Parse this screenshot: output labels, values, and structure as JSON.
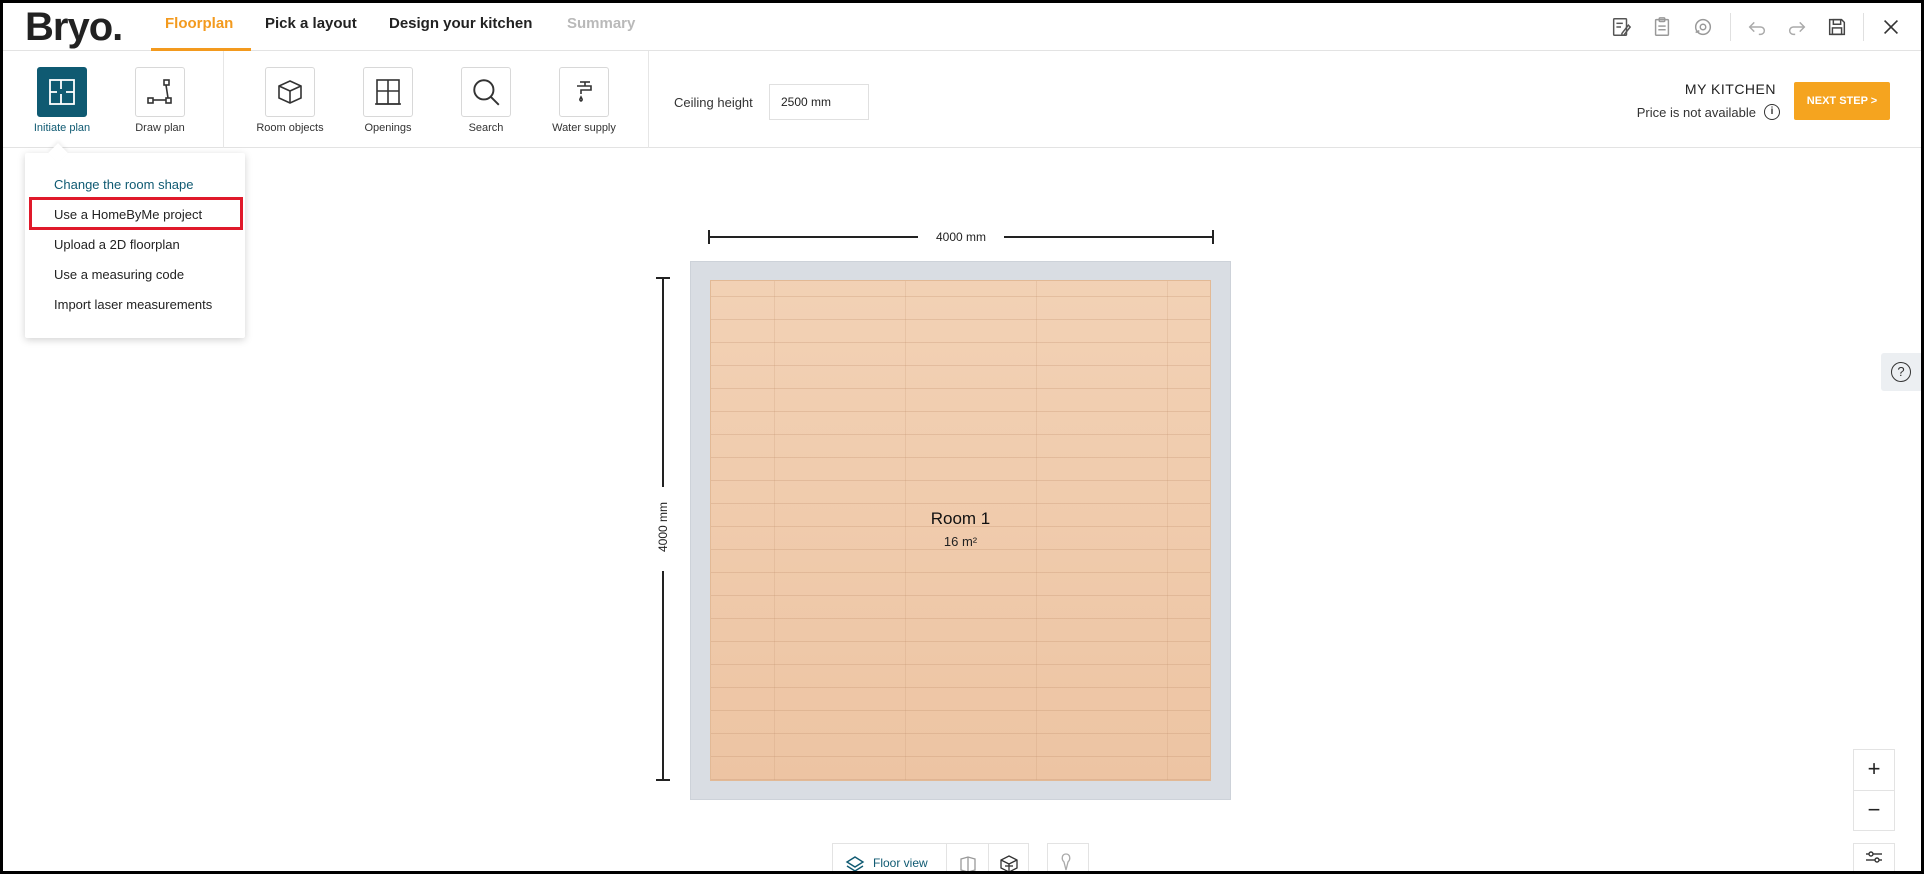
{
  "app": {
    "logo": "Bryo."
  },
  "tabs": [
    {
      "label": "Floorplan",
      "state": "active"
    },
    {
      "label": "Pick a layout",
      "state": "normal"
    },
    {
      "label": "Design your kitchen",
      "state": "normal"
    },
    {
      "label": "Summary",
      "state": "disabled"
    }
  ],
  "top_icons": [
    "edit-list-icon",
    "clipboard-icon",
    "camera-360-icon",
    "undo-icon",
    "redo-icon",
    "save-icon",
    "close-icon"
  ],
  "toolbar": {
    "tools": [
      {
        "label": "Initiate plan",
        "icon": "initiate-plan-icon",
        "active": true
      },
      {
        "label": "Draw plan",
        "icon": "draw-plan-icon",
        "active": false
      },
      {
        "label": "Room objects",
        "icon": "cube-icon",
        "active": false
      },
      {
        "label": "Openings",
        "icon": "window-icon",
        "active": false
      },
      {
        "label": "Search",
        "icon": "search-icon",
        "active": false
      },
      {
        "label": "Water supply",
        "icon": "faucet-icon",
        "active": false
      }
    ],
    "ceiling_label": "Ceiling height",
    "ceiling_value": "2500 mm",
    "kitchen_name": "MY KITCHEN",
    "price_text": "Price is not available",
    "next_button": "NEXT STEP >"
  },
  "dropdown": {
    "items": [
      "Change the room shape",
      "Use a HomeByMe project",
      "Upload a 2D floorplan",
      "Use a measuring code",
      "Import laser measurements"
    ],
    "highlighted": "Use a HomeByMe project"
  },
  "canvas": {
    "width_dimension": "4000 mm",
    "height_dimension": "4000 mm",
    "room_name": "Room 1",
    "room_area": "16 m²"
  },
  "zoom": {
    "plus": "+",
    "minus": "−"
  },
  "viewbar": {
    "floor_view": "Floor view"
  },
  "colors": {
    "accent": "#f39a1e",
    "teal": "#0f5a72",
    "highlight": "#e0192a",
    "next_button": "#f5a41f"
  }
}
